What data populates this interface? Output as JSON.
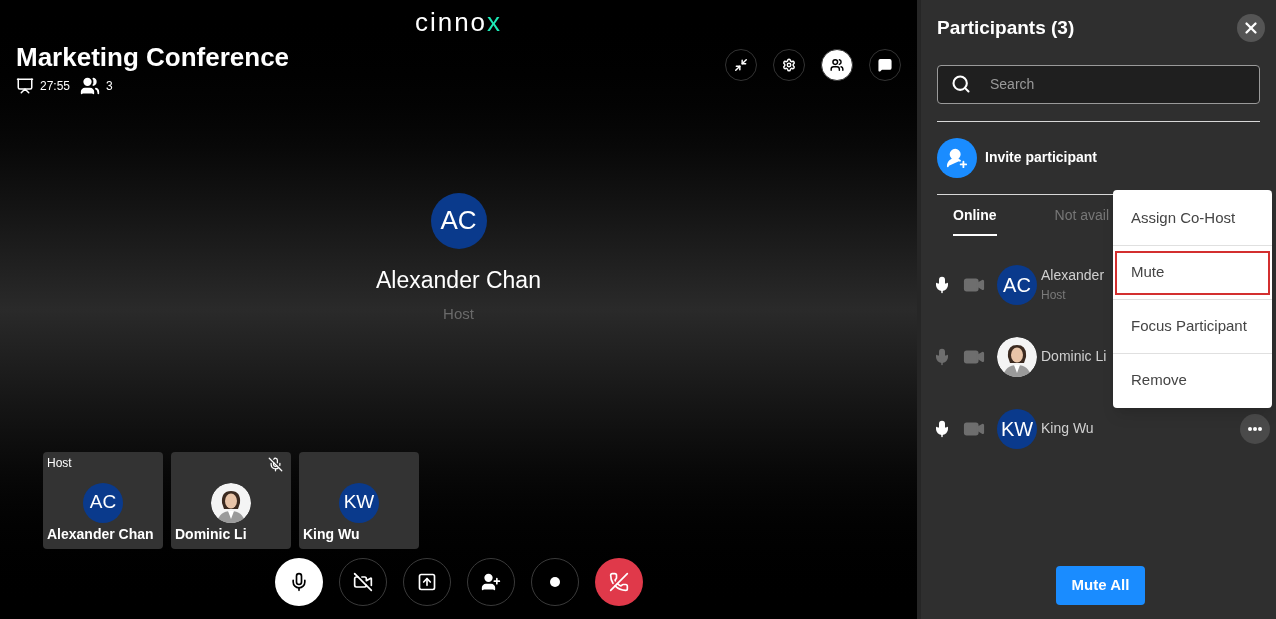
{
  "stage": {
    "logo": {
      "main": "cinno",
      "accent": "x"
    },
    "title": "Marketing Conference",
    "duration": "27:55",
    "attendee_count": "3",
    "top_buttons": [
      {
        "kind": "exit-fullscreen",
        "selected": false
      },
      {
        "kind": "settings",
        "selected": false
      },
      {
        "kind": "participants",
        "selected": true
      },
      {
        "kind": "chat",
        "selected": false
      }
    ],
    "featured": {
      "initials": "AC",
      "name": "Alexander Chan",
      "role": "Host"
    },
    "tiles": [
      {
        "kind": "initials",
        "label": "Host",
        "initials": "AC",
        "name": "Alexander Chan",
        "muted": false
      },
      {
        "name": "Dominic Li",
        "muted": true
      },
      {
        "kind": "initials",
        "initials": "KW",
        "name": "King Wu",
        "muted": false
      }
    ],
    "controls": [
      {
        "kind": "mic",
        "on": true
      },
      {
        "kind": "camera",
        "on": false
      },
      {
        "kind": "share"
      },
      {
        "kind": "add-person"
      },
      {
        "kind": "record"
      },
      {
        "kind": "hang-up"
      }
    ]
  },
  "panel": {
    "title": "Participants (3)",
    "search": {
      "placeholder": "Search"
    },
    "invite": "Invite participant",
    "tabs": [
      {
        "label": "Online",
        "selected": true
      },
      {
        "label": "Not avail",
        "selected": false
      }
    ],
    "participants": [
      {
        "kind": "initials",
        "initials": "AC",
        "name": "Alexander",
        "role": "Host",
        "muted": false,
        "video_on": false
      },
      {
        "name": "Dominic Li",
        "muted": true,
        "video_on": false
      },
      {
        "kind": "initials",
        "initials": "KW",
        "name": "King Wu",
        "muted": false,
        "video_on": false,
        "more_button": true
      }
    ],
    "context_menu": [
      {
        "label": "Assign Co-Host",
        "selected": false
      },
      {
        "label": "Mute",
        "selected": true
      },
      {
        "label": "Focus Participant",
        "selected": false
      },
      {
        "label": "Remove",
        "selected": false
      }
    ],
    "mute_all": "Mute All"
  }
}
